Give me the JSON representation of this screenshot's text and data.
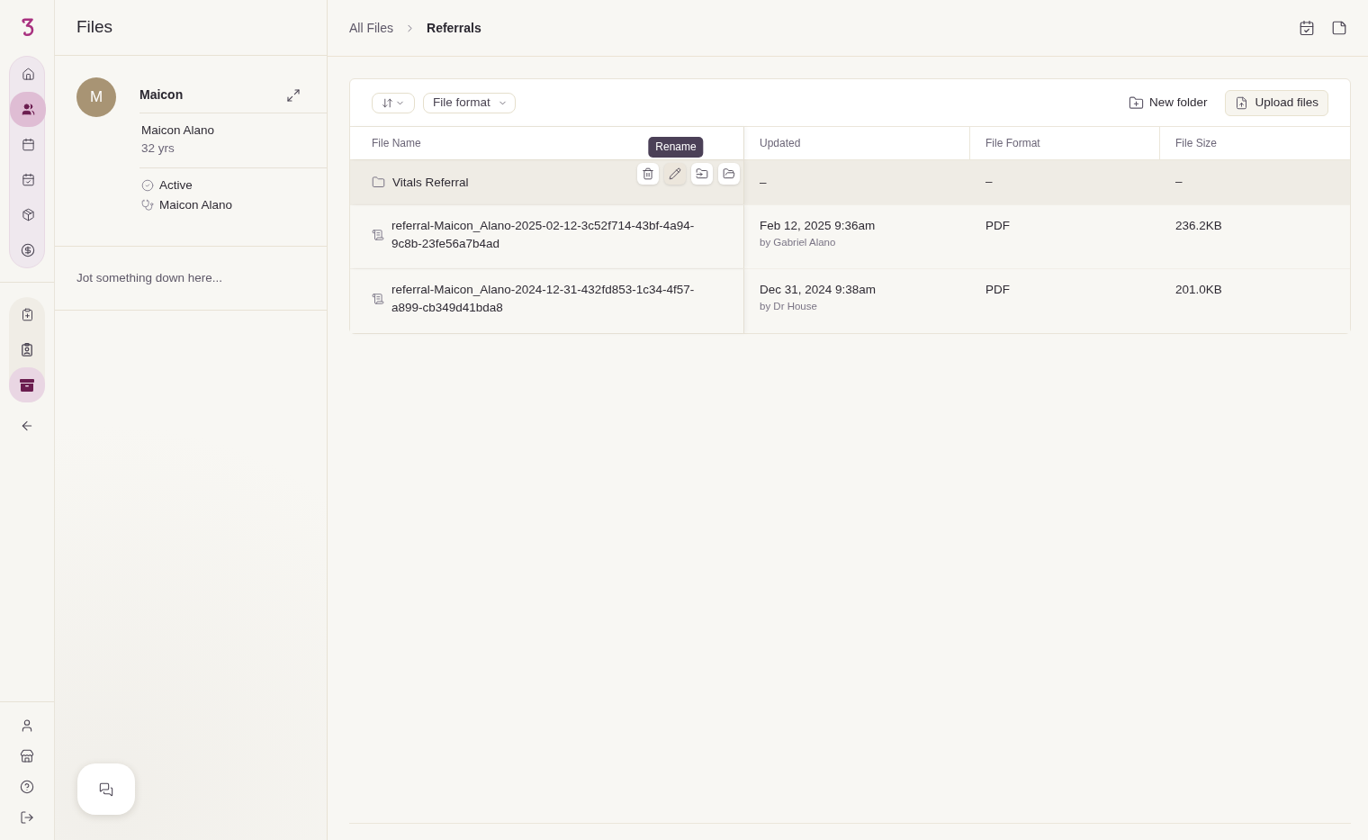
{
  "rail": {
    "main_items": [
      {
        "selected": false
      },
      {
        "selected": true
      },
      {
        "selected": false
      },
      {
        "selected": false
      },
      {
        "selected": false
      },
      {
        "selected": false
      }
    ],
    "record_items": [
      {
        "selected": false
      },
      {
        "selected": false
      },
      {
        "selected": true
      }
    ]
  },
  "panel": {
    "title": "Files",
    "patient": {
      "initial": "M",
      "short_name": "Maicon",
      "full_name": "Maicon Alano",
      "age": "32 yrs",
      "status": "Active",
      "provider": "Maicon Alano"
    },
    "notes": {
      "placeholder": "Jot something down here..."
    }
  },
  "main": {
    "breadcrumb": [
      {
        "label": "All Files",
        "current": false
      },
      {
        "label": "Referrals",
        "current": true
      }
    ],
    "toolbar": {
      "filters": [
        {
          "label": "File format"
        }
      ],
      "new_folder": "New folder",
      "upload": "Upload files"
    },
    "table": {
      "columns": [
        "File Name",
        "Updated",
        "File Format",
        "File Size"
      ],
      "rows": [
        {
          "kind": "folder",
          "name": "Vitals Referral",
          "updated": "–",
          "format": "–",
          "size": "–",
          "hovered": true,
          "actions": [
            {
              "hovered": false
            },
            {
              "hovered": true,
              "tooltip": "Rename"
            },
            {
              "hovered": false
            },
            {
              "hovered": false
            }
          ]
        },
        {
          "kind": "file",
          "name": "referral-Maicon_Alano-2025-02-12-3c52f714-43bf-4a94-9c8b-23fe56a7b4ad",
          "updated": "Feb 12, 2025 9:36am",
          "updated_by": "by Gabriel Alano",
          "format": "PDF",
          "size": "236.2KB",
          "hovered": false
        },
        {
          "kind": "file",
          "name": "referral-Maicon_Alano-2024-12-31-432fd853-1c34-4f57-a899-cb349d41bda8",
          "updated": "Dec 31, 2024 9:38am",
          "updated_by": "by Dr House",
          "format": "PDF",
          "size": "201.0KB",
          "hovered": false
        }
      ]
    }
  }
}
